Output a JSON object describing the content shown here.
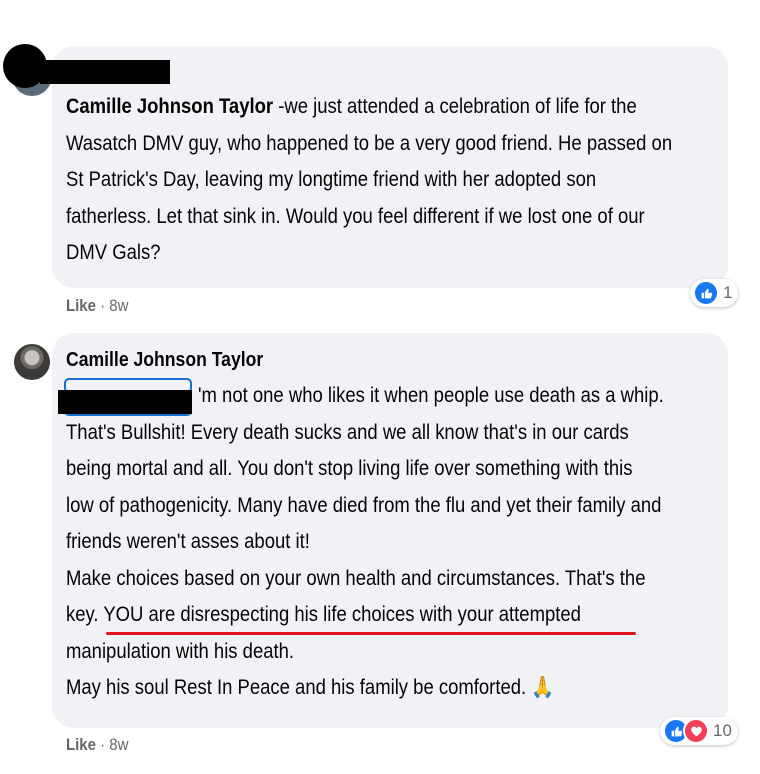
{
  "comments": [
    {
      "author_name": "Camille Johnson Taylor",
      "body_lines_after_name": [
        " -we just attended a celebration of life for the"
      ],
      "body_lines": [
        "Wasatch DMV guy, who happened to be a very good friend. He passed on",
        "St Patrick's Day, leaving my longtime friend with her adopted son",
        "fatherless. Let that sink in. Would you feel different if we lost one of our",
        "DMV Gals?"
      ],
      "like_label": "Like",
      "time": "8w",
      "reaction_count": "1",
      "reaction_types": [
        "like"
      ]
    },
    {
      "author": "Camille Johnson Taylor",
      "first_line": "'m not one who likes it when people use death as a whip.",
      "body_lines": [
        "That's Bullshit! Every death sucks and we all know that's in our cards",
        "being mortal and all. You don't stop living life over something with this",
        "low of pathogenicity. Many have died from the flu and yet their family and",
        "friends weren't asses about it!",
        "Make choices based on your own health and circumstances. That's the"
      ],
      "key_prefix": "key. ",
      "underlined_text": "YOU are disrespecting his life choices with your attempted",
      "tail_lines": [
        "manipulation with his death.",
        "May his soul Rest In Peace and his family be comforted. 🙏"
      ],
      "like_label": "Like",
      "time": "8w",
      "reaction_count": "10",
      "reaction_types": [
        "like",
        "love"
      ]
    }
  ],
  "colors": {
    "bubble": "#f0f2f5",
    "like_blue": "#1877f2",
    "love_red": "#f33e58",
    "underline_red": "#e0141e",
    "mention_border": "#1a6fd6",
    "meta_gray": "#65676b"
  }
}
